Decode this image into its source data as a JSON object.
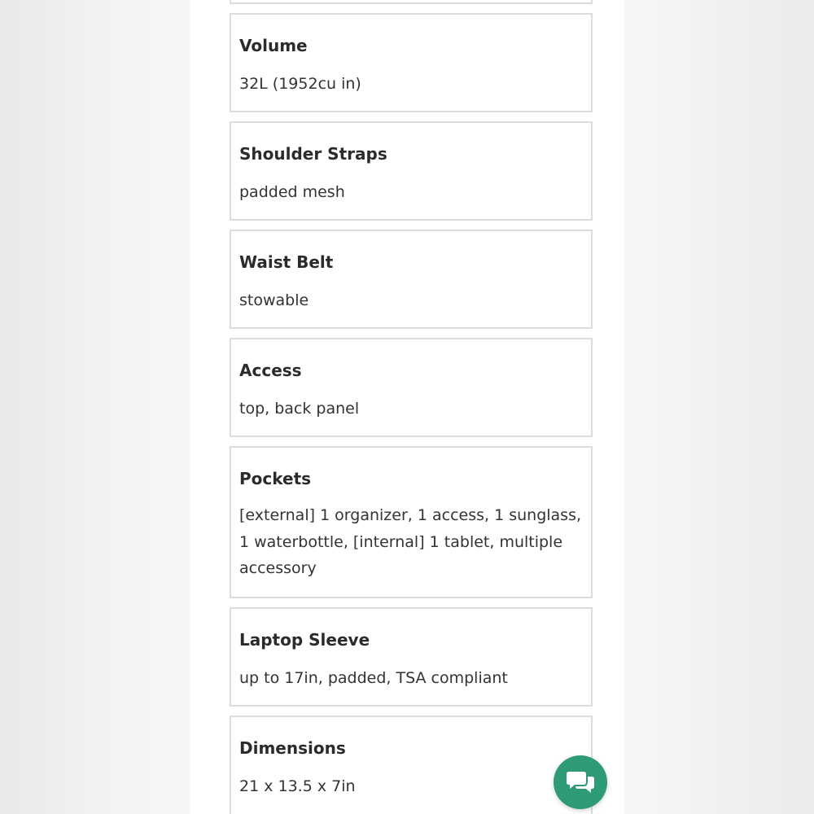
{
  "specs": [
    {
      "label": "Volume",
      "value": "32L (1952cu in)"
    },
    {
      "label": "Shoulder Straps",
      "value": "padded mesh"
    },
    {
      "label": "Waist Belt",
      "value": "stowable"
    },
    {
      "label": "Access",
      "value": "top, back panel"
    },
    {
      "label": "Pockets",
      "value": "[external] 1 organizer, 1 access, 1 sunglass, 1 waterbottle, [internal] 1 tablet, multiple accessory"
    },
    {
      "label": "Laptop Sleeve",
      "value": "up to 17in, padded, TSA compliant"
    },
    {
      "label": "Dimensions",
      "value": "21 x 13.5 x 7in"
    }
  ],
  "chat_button": {
    "icon": "chat-bubbles-icon",
    "color": "#2f9a78"
  }
}
